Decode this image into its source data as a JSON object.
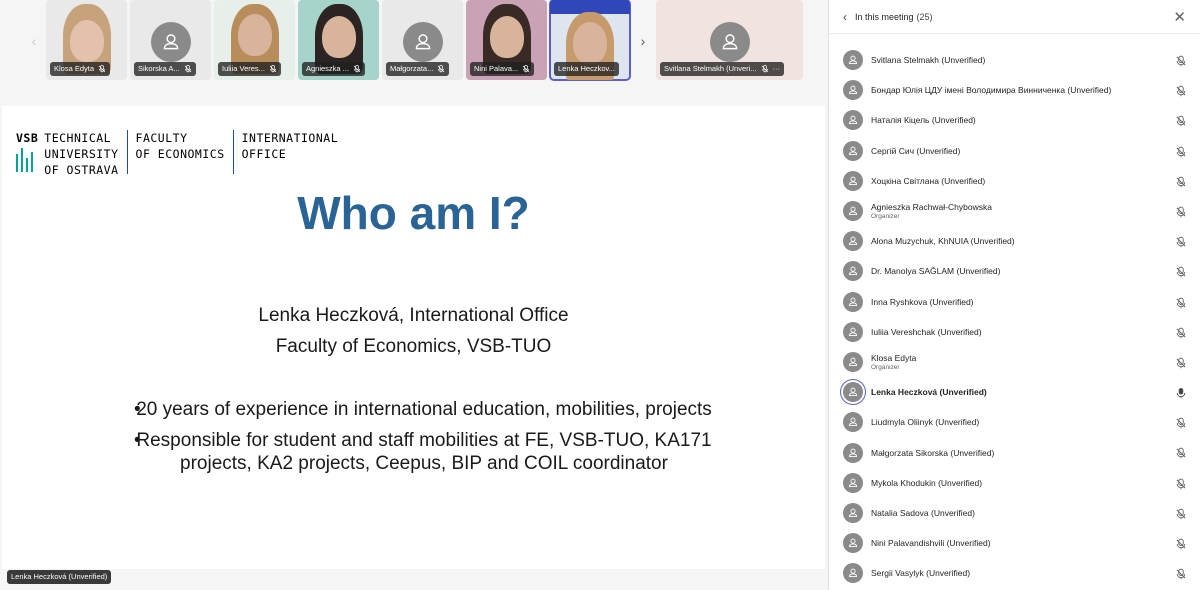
{
  "strip": {
    "prev_arrow": "‹",
    "next_arrow": "›",
    "tiles": [
      {
        "name": "Klosa Edyta",
        "bg": "#c9b49a"
      },
      {
        "name": "Sikorska A...",
        "bg": "#ecd9e1"
      },
      {
        "name": "Iuliia Veres...",
        "bg": "#e6efe9"
      },
      {
        "name": "Agnieszka ...",
        "bg": "#a6d4cb"
      },
      {
        "name": "Małgorzata...",
        "bg": "#e3dbd6"
      },
      {
        "name": "Nini Palava...",
        "bg": "#c9a2b5"
      },
      {
        "name": "Lenka Heczkov...",
        "bg": "#dfe5ef"
      },
      {
        "name": "Svitlana Stelmakh (Unveri...",
        "bg": "#ecd9d4"
      }
    ],
    "more_icon": "···"
  },
  "slide": {
    "logo": {
      "vsb": "VSB",
      "line1": "TECHNICAL",
      "line2": "UNIVERSITY",
      "line3": "OF OSTRAVA",
      "fac1": "FACULTY",
      "fac2": "OF ECONOMICS",
      "int1": "INTERNATIONAL",
      "int2": "OFFICE"
    },
    "title": "Who am I?",
    "line1": "Lenka Heczková, International Office",
    "line2": "Faculty of Economics, VSB-TUO",
    "bullets": [
      "20 years of experience in international education, mobilities, projects",
      "Responsible for student and staff mobilities at FE, VSB-TUO, KA171 projects, KA2 projects, Ceepus, BIP and COIL coordinator"
    ],
    "presenter_tag": "Lenka Heczková (Unverified)"
  },
  "panel": {
    "title": "In this meeting",
    "count": "(25)",
    "participants": [
      {
        "name": "Svitlana Stelmakh (Unverified)",
        "role": "",
        "muted": true
      },
      {
        "name": "Бондар Юлія ЦДУ імені Володимира Винниченка (Unverified)",
        "role": "",
        "muted": true
      },
      {
        "name": "Наталія Кіцель (Unverified)",
        "role": "",
        "muted": true
      },
      {
        "name": "Сергій Сич (Unverified)",
        "role": "",
        "muted": true
      },
      {
        "name": "Хоцкіна Світлана (Unverified)",
        "role": "",
        "muted": true
      },
      {
        "name": "Agnieszka Rachwał-Chybowska",
        "role": "Organizer",
        "muted": true
      },
      {
        "name": "Alona Muzychuk, KhNUIA (Unverified)",
        "role": "",
        "muted": true
      },
      {
        "name": "Dr. Manolya SAĞLAM (Unverified)",
        "role": "",
        "muted": true
      },
      {
        "name": "Inna Ryshkova (Unverified)",
        "role": "",
        "muted": true
      },
      {
        "name": "Iuliia Vereshchak (Unverified)",
        "role": "",
        "muted": true
      },
      {
        "name": "Klosa Edyta",
        "role": "Organizer",
        "muted": true
      },
      {
        "name": "Lenka Heczková (Unverified)",
        "role": "",
        "muted": false,
        "speaking": true
      },
      {
        "name": "Liudmyla Oliinyk (Unverified)",
        "role": "",
        "muted": true
      },
      {
        "name": "Małgorzata Sikorska (Unverified)",
        "role": "",
        "muted": true
      },
      {
        "name": "Mykola Khodukin (Unverified)",
        "role": "",
        "muted": true
      },
      {
        "name": "Natalia Sadova (Unverified)",
        "role": "",
        "muted": true
      },
      {
        "name": "Nini Palavandishvili (Unverified)",
        "role": "",
        "muted": true
      },
      {
        "name": "Sergii Vasylyk (Unverified)",
        "role": "",
        "muted": true
      }
    ]
  },
  "colors": {
    "accent": "#5b5fc7",
    "title_blue": "#2a6496",
    "vsb_green": "#00a499",
    "vsb_blue": "#1c4e9c"
  }
}
